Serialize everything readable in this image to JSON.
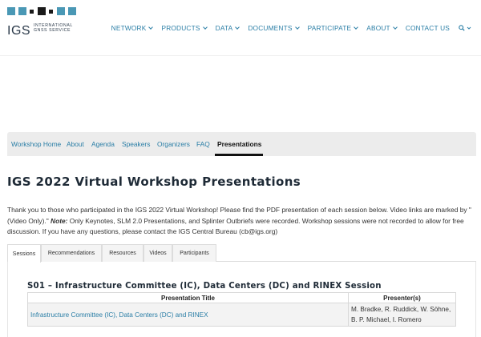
{
  "header": {
    "logo_text": "IGS",
    "logo_sub": "INTERNATIONAL GNSS SERVICE",
    "logo_colors": [
      "#4a98b5",
      "#1a1a1a",
      "#1a1a1a",
      "#4a98b5",
      "#4a98b5"
    ],
    "nav": [
      {
        "label": "NETWORK",
        "icon": "chevron-down-icon"
      },
      {
        "label": "PRODUCTS",
        "icon": "chevron-down-icon"
      },
      {
        "label": "DATA",
        "icon": "chevron-down-icon"
      },
      {
        "label": "DOCUMENTS",
        "icon": "chevron-down-icon"
      },
      {
        "label": "PARTICIPATE",
        "icon": "chevron-down-icon"
      },
      {
        "label": "ABOUT",
        "icon": "chevron-down-icon"
      },
      {
        "label": "CONTACT US"
      }
    ],
    "search_icon": "search-icon"
  },
  "subnav": {
    "items": [
      "Workshop Home",
      "About",
      "Agenda",
      "Speakers",
      "Organizers",
      "FAQ",
      "Presentations"
    ],
    "active": "Presentations"
  },
  "page": {
    "title": "IGS 2022 Virtual Workshop Presentations",
    "intro_part1": "Thank you to those who participated in the IGS 2022 Virtual Workshop! Please find the PDF presentation of each session below. Video links are marked by \"(Video Only).\" ",
    "intro_note": "Note:",
    "intro_part2": " Only Keynotes, SLM 2.0 Presentations, and Splinter Outbriefs were recorded. Workshop sessions were not recorded to allow for free discussion. If you have any questions, please contact the IGS Central Bureau (cb@igs.org)"
  },
  "tabs": {
    "items": [
      "Sessions",
      "Recommendations",
      "Resources",
      "Videos",
      "Participants"
    ],
    "active": "Sessions"
  },
  "session": {
    "title": "S01 – Infrastructure Committee (IC), Data Centers (DC) and RINEX Session",
    "headers": [
      "Presentation Title",
      "Presenter(s)"
    ],
    "rows": [
      {
        "title": "Infrastructure Committee (IC), Data Centers (DC) and RINEX",
        "presenters": "M. Bradke, R. Ruddick, W. Söhne, B. P. Michael, I. Romero"
      }
    ]
  },
  "colors": {
    "link": "#2a7ea6",
    "heading": "#1e2a36",
    "subnav_bg": "#ececec"
  }
}
